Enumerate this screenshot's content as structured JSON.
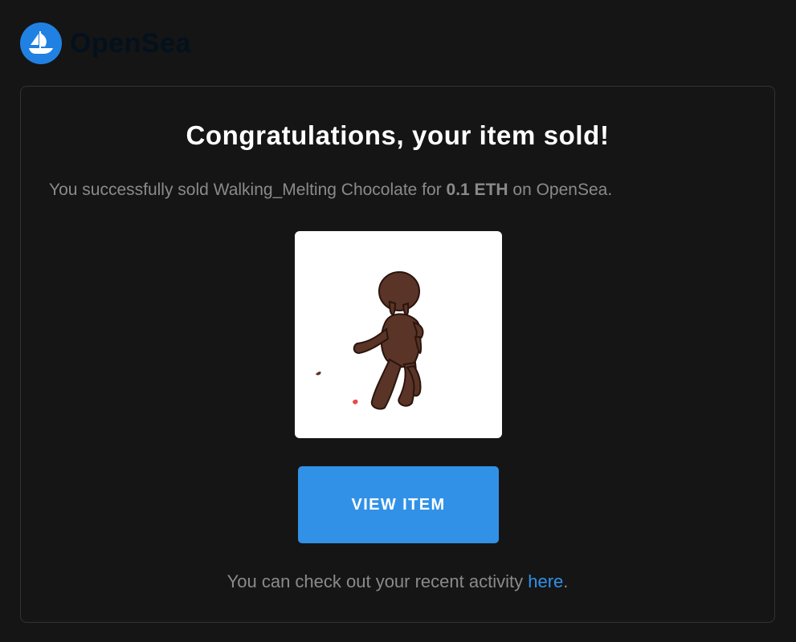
{
  "brand": {
    "name": "OpenSea",
    "accent_color": "#2081e2"
  },
  "card": {
    "title": "Congratulations, your item sold!",
    "message_prefix": "You successfully sold Walking_Melting Chocolate for ",
    "message_amount": "0.1 ETH",
    "message_suffix": " on OpenSea.",
    "item_image": "walking-melting-chocolate-figure",
    "button_label": "VIEW ITEM",
    "button_color": "#3191e7",
    "footer_prefix": "You can check out your recent activity ",
    "footer_link": "here",
    "footer_suffix": "."
  }
}
